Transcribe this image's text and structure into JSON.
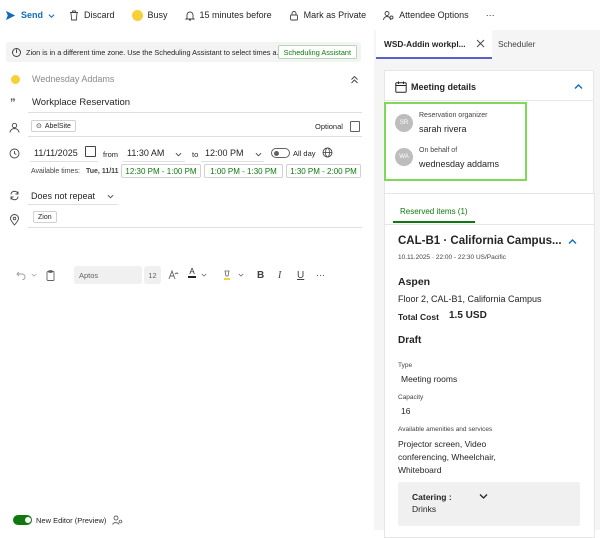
{
  "toolbar": {
    "send": "Send",
    "discard": "Discard",
    "busy": "Busy",
    "reminder": "15 minutes before",
    "private": "Mark as Private",
    "attendee": "Attendee Options",
    "more": "···"
  },
  "banner": {
    "text": "Zion is in a different time zone. Use the Scheduling Assistant to select times a...",
    "button": "Scheduling Assistant"
  },
  "form": {
    "attendee_placeholder": "Wednesday Addams",
    "title": "Workplace Reservation",
    "required_chip": "AbelSite",
    "optional": "Optional",
    "date": "11/11/2025",
    "from_label": "from",
    "start_time": "11:30 AM",
    "to_label": "to",
    "end_time": "12:00 PM",
    "all_day": "All day",
    "available_label": "Available times:",
    "available_day": "Tue, 11/11",
    "slots": [
      "12:30 PM - 1:00 PM",
      "1:00 PM - 1:30 PM",
      "1:30 PM - 2:00 PM"
    ],
    "repeat": "Does not repeat",
    "location_chip": "Zion"
  },
  "format": {
    "font": "Aptos",
    "size": "12",
    "more": "···"
  },
  "footer": {
    "editor": "New Editor (Preview)"
  },
  "pane": {
    "tab_active": "WSD-Addin workpl...",
    "tab_scheduler": "Scheduler",
    "meeting_details": "Meeting details",
    "organizer_label": "Reservation organizer",
    "organizer_initials": "SR",
    "organizer_name": "sarah rivera",
    "behalf_label": "On behalf of",
    "behalf_initials": "WA",
    "behalf_name": "wednesday addams",
    "reserved_tab": "Reserved items (1)",
    "item_title": "CAL-B1 · California Campus...",
    "item_time": "10.11.2025 · 22:00 - 22:30 US/Pacific",
    "room_name": "Aspen",
    "room_location": "Floor 2, CAL-B1, California Campus",
    "total_cost_label": "Total Cost",
    "total_cost_value": "1.5 USD",
    "status": "Draft",
    "type_label": "Type",
    "type_value": "Meeting rooms",
    "capacity_label": "Capacity",
    "capacity_value": "16",
    "amenities_label": "Available amenities and services",
    "amenities_value": "Projector screen, Video conferencing, Wheelchair, Whiteboard",
    "catering_label": "Catering :",
    "catering_value": "Drinks"
  },
  "colors": {
    "accent_green": "#0e7a0d",
    "highlight_box": "#7ed957",
    "purple_tab": "#5b5fc7",
    "blue_chevron": "#0f6cbd"
  }
}
